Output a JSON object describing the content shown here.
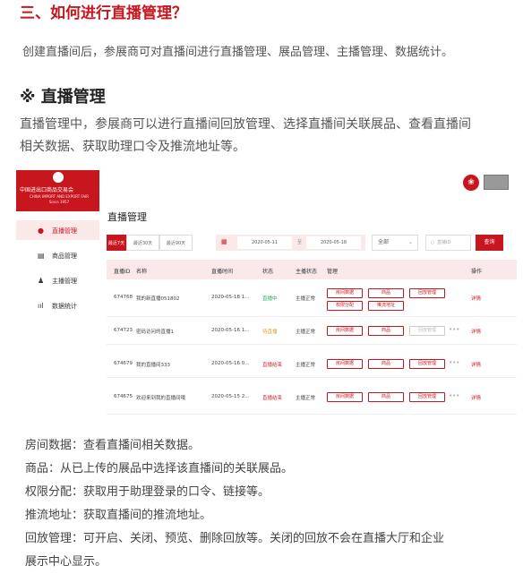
{
  "heading": "三、如何进行直播管理？",
  "intro": "创建直播间后，参展商可对直播间进行直播管理、展品管理、主播管理、数据统计。",
  "section_title": "※ 直播管理",
  "paragraph_lines": [
    "直播管理中，参展商可以进行直播间回放管理、选择直播间关联展品、查看直播间",
    "相关数据、获取助理口令及推流地址等。"
  ],
  "app": {
    "logo_cn": "中国进出口商品交易会",
    "logo_en": "CHINA IMPORT AND EXPORT FAIR",
    "logo_since": "Since 1957",
    "nav": [
      {
        "label": "直播管理",
        "icon": "●",
        "active": true
      },
      {
        "label": "商品管理",
        "icon": "▤",
        "active": false
      },
      {
        "label": "主播管理",
        "icon": "♟",
        "active": false
      },
      {
        "label": "数据统计",
        "icon": "ııl",
        "active": false
      }
    ],
    "badge_icon": "❀",
    "page_title": "直播管理",
    "filters": {
      "ranges": [
        "最近7天",
        "最近30天",
        "最近90天"
      ],
      "date_start": "2020-05-11",
      "date_sep": "至",
      "date_end": "2020-05-18",
      "calendar_icon": "▦",
      "status_select": "全部",
      "search_placeholder": "直播ID",
      "search_icon": "○",
      "query_label": "查询"
    },
    "columns": [
      "直播ID",
      "名称",
      "直播时间",
      "状态",
      "主播状态",
      "管理",
      "操作"
    ],
    "rows": [
      {
        "id": "674768",
        "name": "我的新直播051802",
        "time": "2020-05-18 1...",
        "status": "直播中",
        "anchor": "主播正常",
        "detail": "详情"
      },
      {
        "id": "674723",
        "name": "密码访问的直播1",
        "time": "2020-05-16 1...",
        "status": "待直播",
        "anchor": "主播正常",
        "detail": "详情"
      },
      {
        "id": "674679",
        "name": "我的直播间333",
        "time": "2020-05-16 0...",
        "status": "直播结束",
        "anchor": "主播正常",
        "detail": "详情"
      },
      {
        "id": "674675",
        "name": "欢迎来到我的直播间哦",
        "time": "2020-05-15 2...",
        "status": "直播结束",
        "anchor": "主播正常",
        "detail": "详情"
      }
    ],
    "tags": {
      "room_data": "房间数据",
      "goods": "商品",
      "replay": "回放管理",
      "permission": "权限分配",
      "push_url": "推流地址",
      "more": "•••"
    }
  },
  "descriptions": [
    "房间数据：查看直播间相关数据。",
    "商品：从已上传的展品中选择该直播间的关联展品。",
    "权限分配：获取用于助理登录的口令、链接等。",
    "推流地址：获取直播间的推流地址。",
    "回放管理：可开启、关闭、预览、删除回放等。关闭的回放不会在直播大厅和企业",
    "展示中心显示。"
  ],
  "colors": {
    "brand": "#c8161e",
    "live": "#2aaa5a",
    "pending": "#e89a2c",
    "ended": "#d62a2a"
  }
}
